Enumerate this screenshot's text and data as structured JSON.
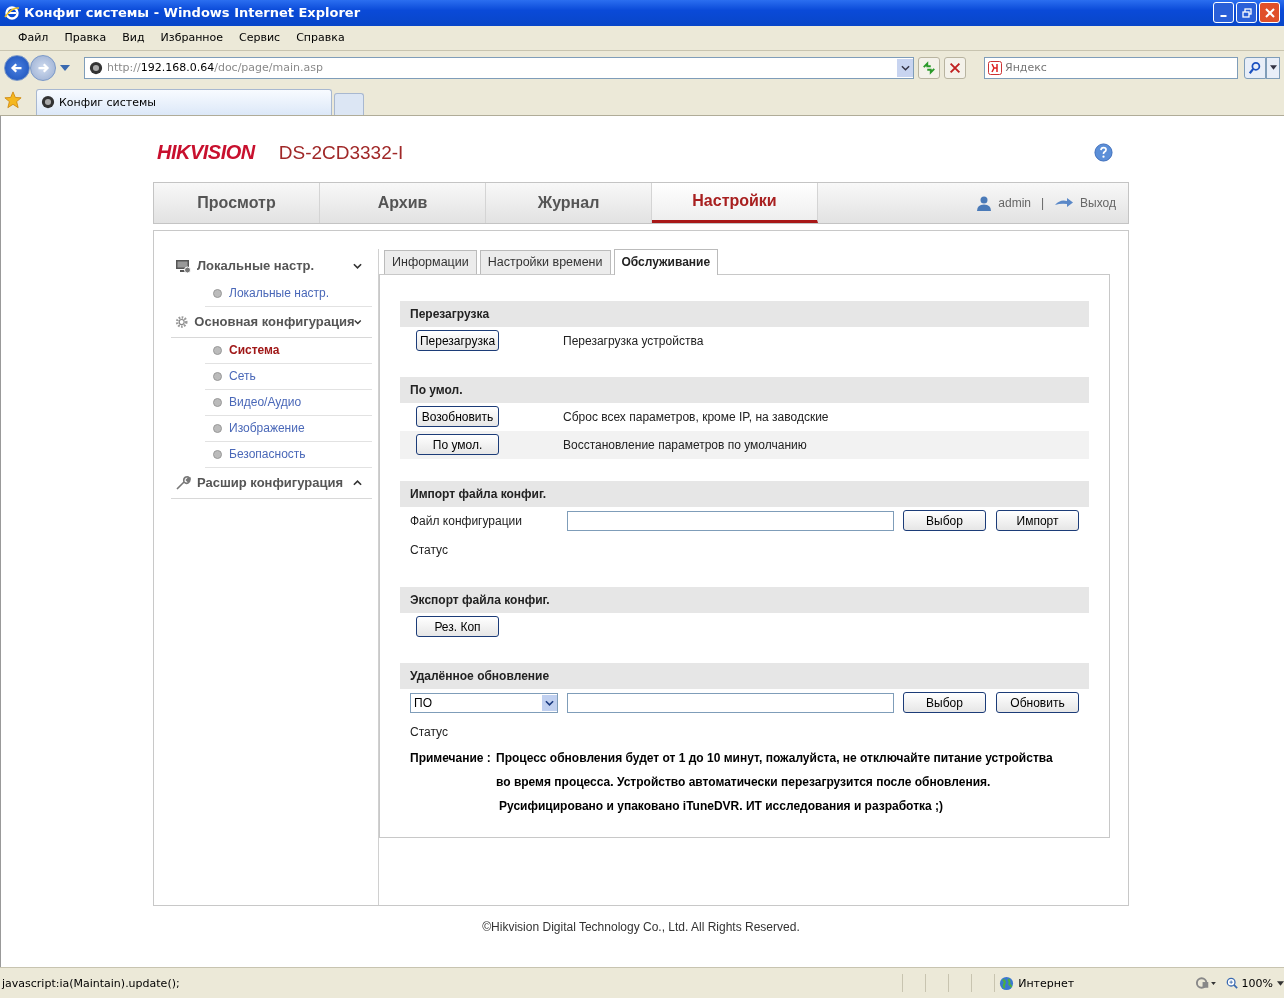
{
  "window": {
    "title": "Конфиг системы - Windows Internet Explorer"
  },
  "menu": [
    "Файл",
    "Правка",
    "Вид",
    "Избранное",
    "Сервис",
    "Справка"
  ],
  "address": {
    "scheme": "http://",
    "host": "192.168.0.64",
    "path": "/doc/page/main.asp"
  },
  "search": {
    "placeholder": "Яндекс"
  },
  "browser_tabs": [
    {
      "label": "Конфиг системы",
      "selected": true
    }
  ],
  "header": {
    "brand": "HIKVISION",
    "model": "DS-2CD3332-I"
  },
  "nav": [
    {
      "label": "Просмотр",
      "selected": false
    },
    {
      "label": "Архив",
      "selected": false
    },
    {
      "label": "Журнал",
      "selected": false
    },
    {
      "label": "Настройки",
      "selected": true
    }
  ],
  "user": {
    "name": "admin",
    "separator": "|",
    "logout": "Выход"
  },
  "sidebar": [
    {
      "label": "Локальные настр.",
      "kind": "monitor",
      "expanded": true,
      "children": [
        {
          "label": "Локальные настр.",
          "selected": false
        }
      ]
    },
    {
      "label": "Основная конфигурация",
      "kind": "gear",
      "expanded": true,
      "children": [
        {
          "label": "Система",
          "selected": true
        },
        {
          "label": "Сеть",
          "selected": false
        },
        {
          "label": "Видео/Аудио",
          "selected": false
        },
        {
          "label": "Изображение",
          "selected": false
        },
        {
          "label": "Безопасность",
          "selected": false
        }
      ]
    },
    {
      "label": "Расшир конфигурация",
      "kind": "wrench",
      "expanded": false
    }
  ],
  "subtabs": [
    {
      "label": "Информации",
      "selected": false
    },
    {
      "label": "Настройки времени",
      "selected": false
    },
    {
      "label": "Обслуживание",
      "selected": true
    }
  ],
  "sections": [
    {
      "title": "Перезагрузка",
      "rows": [
        {
          "kind": "action",
          "button": "Перезагрузка",
          "text": "Перезагрузка устройства",
          "highlighted": false
        }
      ]
    },
    {
      "title": "По умол.",
      "rows": [
        {
          "kind": "action",
          "button": "Возобновить",
          "text": "Сброс всех параметров, кроме IP, на заводские",
          "highlighted": false
        },
        {
          "kind": "action",
          "button": "По умол.",
          "text": "Восстановление параметров по умолчанию",
          "highlighted": true
        }
      ]
    },
    {
      "title": "Импорт файла конфиг.",
      "rows": [
        {
          "kind": "file",
          "label": "Файл конфигурации",
          "buttons": [
            "Выбор",
            "Импорт"
          ]
        },
        {
          "kind": "status",
          "label": "Статус"
        }
      ]
    },
    {
      "title": "Экспорт файла конфиг.",
      "rows": [
        {
          "kind": "action",
          "button": "Рез. Коп",
          "highlighted": false
        }
      ]
    },
    {
      "title": "Удалённое обновление",
      "rows": [
        {
          "kind": "select_file",
          "select": "ПО",
          "buttons": [
            "Выбор",
            "Обновить"
          ]
        },
        {
          "kind": "status",
          "label": "Статус"
        },
        {
          "kind": "note",
          "label": "Примечание :",
          "lines": [
            "Процесс обновления будет от 1 до 10 минут, пожалуйста, не отключайте питание устройства",
            "во время процесса. Устройство автоматически перезагрузится после обновления.",
            "Русифицировано и упаковано iTuneDVR. ИТ исследования и разработка ;)"
          ]
        }
      ]
    }
  ],
  "footer": "©Hikvision Digital Technology Co., Ltd. All Rights Reserved.",
  "status_bar": {
    "text": "javascript:ia(Maintain).update();",
    "zone": "Интернет",
    "zoom": "100%"
  }
}
